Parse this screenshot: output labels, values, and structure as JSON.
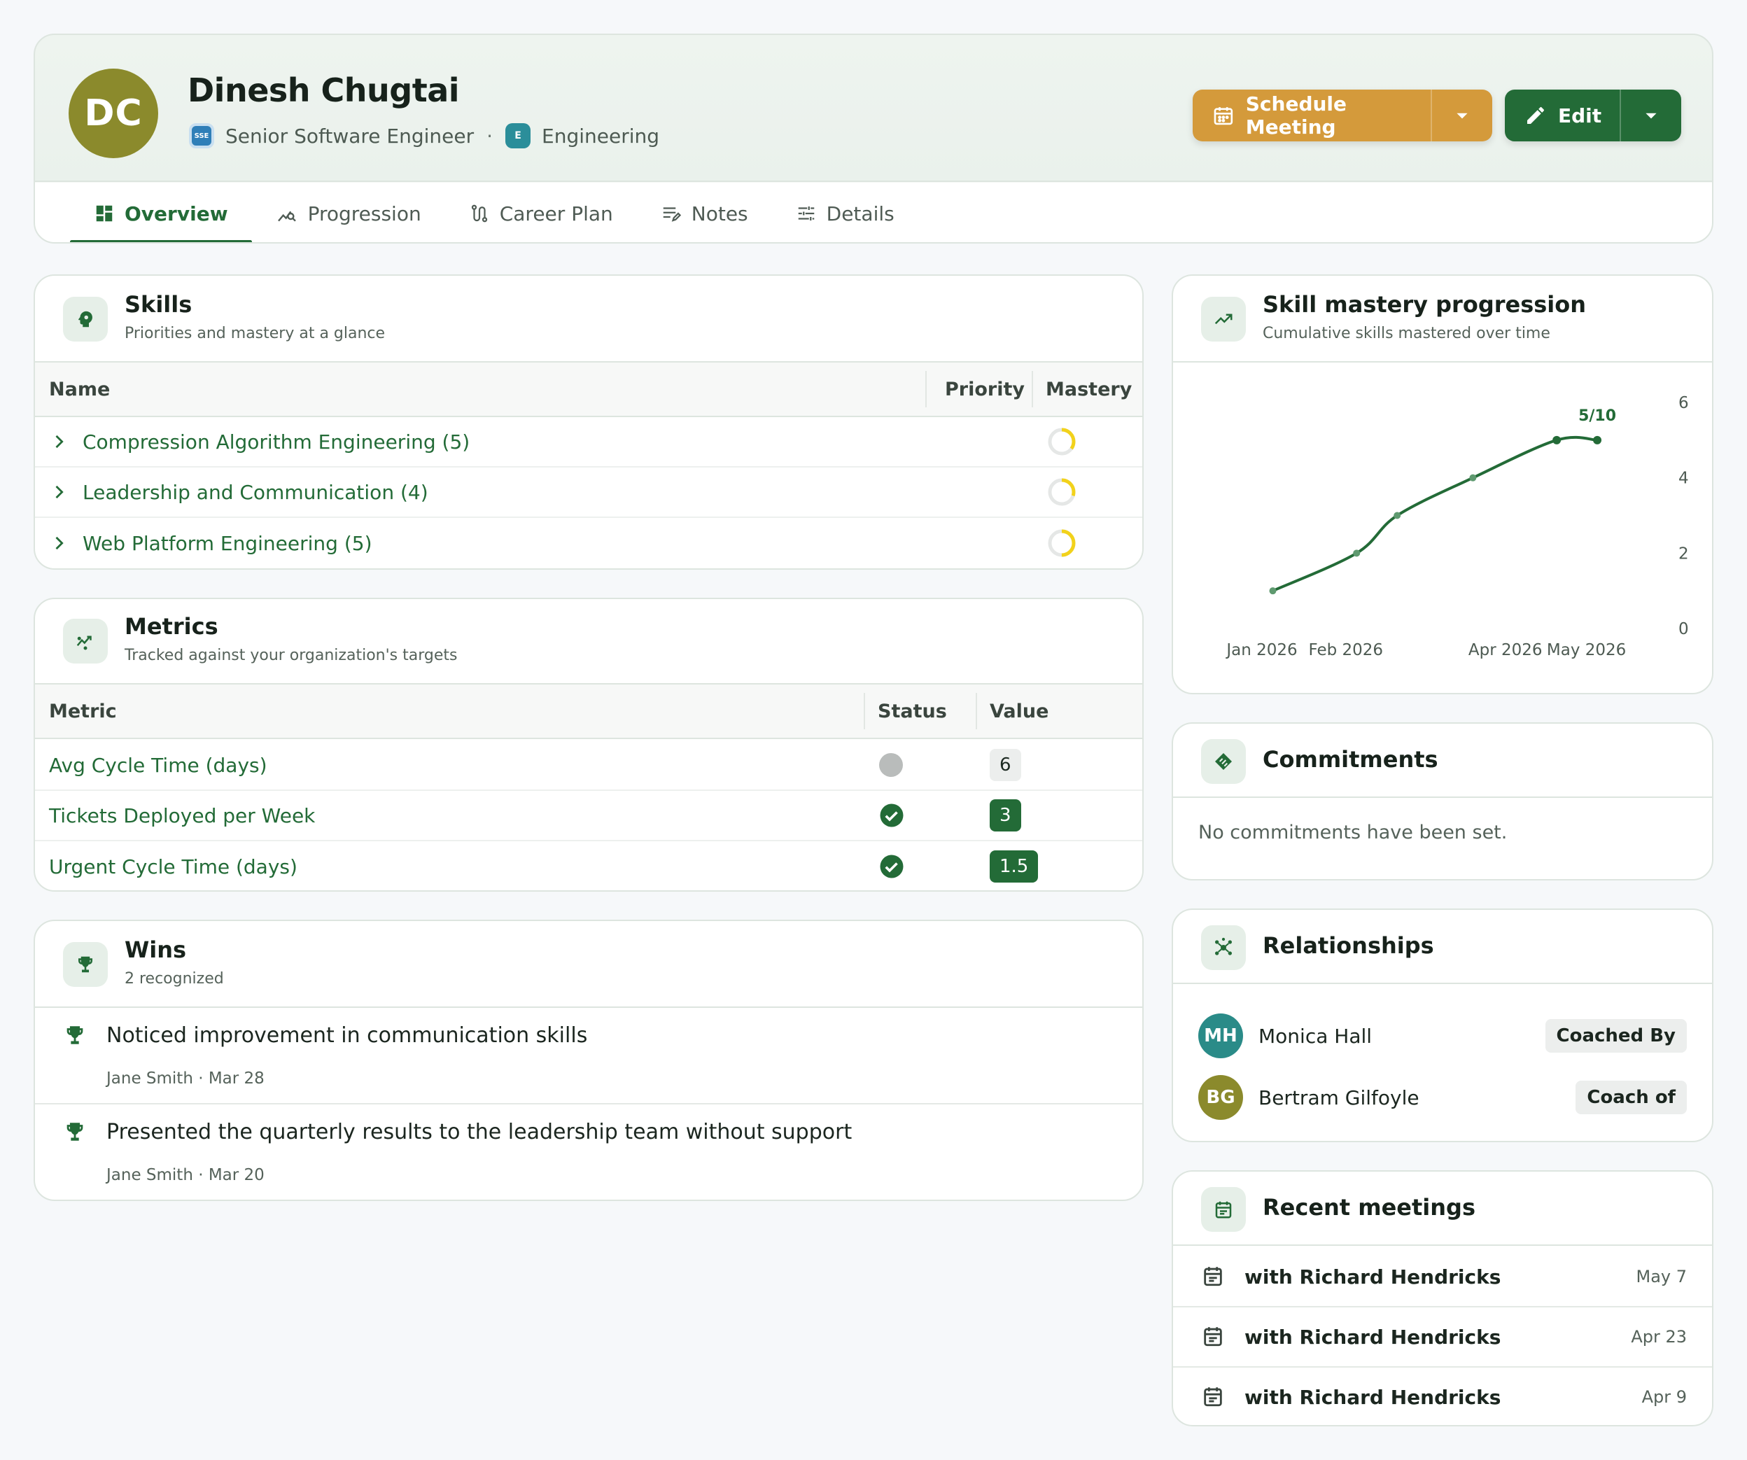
{
  "profile": {
    "initials": "DC",
    "name": "Dinesh Chugtai",
    "role_chip": "SSE",
    "role": "Senior Software Engineer",
    "separator": "·",
    "department_chip": "E",
    "department": "Engineering",
    "avatar_color": "#8b8a2c"
  },
  "actions": {
    "schedule_label": "Schedule Meeting",
    "edit_label": "Edit"
  },
  "tabs": [
    {
      "label": "Overview",
      "icon": "dashboard-icon",
      "active": true
    },
    {
      "label": "Progression",
      "icon": "trend-search-icon"
    },
    {
      "label": "Career Plan",
      "icon": "route-icon"
    },
    {
      "label": "Notes",
      "icon": "notes-icon"
    },
    {
      "label": "Details",
      "icon": "tune-icon"
    }
  ],
  "skills": {
    "title": "Skills",
    "subtitle": "Priorities and mastery at a glance",
    "columns": {
      "name": "Name",
      "priority": "Priority",
      "mastery": "Mastery"
    },
    "rows": [
      {
        "name": "Compression Algorithm Engineering (5)",
        "mastery": 0.35
      },
      {
        "name": "Leadership and Communication (4)",
        "mastery": 0.3
      },
      {
        "name": "Web Platform Engineering (5)",
        "mastery": 0.5
      }
    ]
  },
  "metrics": {
    "title": "Metrics",
    "subtitle": "Tracked against your organization's targets",
    "columns": {
      "metric": "Metric",
      "status": "Status",
      "value": "Value"
    },
    "rows": [
      {
        "name": "Avg Cycle Time (days)",
        "status": "neutral",
        "value": "6"
      },
      {
        "name": "Tickets Deployed per Week",
        "status": "good",
        "value": "3"
      },
      {
        "name": "Urgent Cycle Time (days)",
        "status": "good",
        "value": "1.5"
      }
    ]
  },
  "wins": {
    "title": "Wins",
    "subtitle": "2 recognized",
    "items": [
      {
        "text": "Noticed improvement in communication skills",
        "meta": "Jane Smith · Mar 28"
      },
      {
        "text": "Presented the quarterly results to the leadership team without support",
        "meta": "Jane Smith · Mar 20"
      }
    ]
  },
  "progression": {
    "title": "Skill mastery progression",
    "subtitle": "Cumulative skills mastered over time"
  },
  "chart_data": {
    "type": "line",
    "series": [
      {
        "points": [
          {
            "x": "2026-01-05",
            "y": 1
          },
          {
            "x": "2026-02-05",
            "y": 2
          },
          {
            "x": "2026-02-20",
            "y": 3
          },
          {
            "x": "2026-03-20",
            "y": 4
          },
          {
            "x": "2026-04-20",
            "y": 5
          },
          {
            "x": "2026-05-05",
            "y": 5
          }
        ]
      }
    ],
    "x_ticks": [
      "Jan 2026",
      "Feb 2026",
      "Apr 2026",
      "May 2026"
    ],
    "y_ticks": [
      "0",
      "2",
      "4",
      "6"
    ],
    "ylim": [
      0,
      6
    ],
    "xlim": [
      "2025-12-25",
      "2026-05-20"
    ],
    "last_label": "5/10",
    "y_axis_position": "right",
    "grid": false,
    "line_color": "#236b37"
  },
  "commitments": {
    "title": "Commitments",
    "empty_text": "No commitments have been set."
  },
  "relationships": {
    "title": "Relationships",
    "items": [
      {
        "initials": "MH",
        "name": "Monica Hall",
        "badge": "Coached By",
        "color": "#2a8b88"
      },
      {
        "initials": "BG",
        "name": "Bertram Gilfoyle",
        "badge": "Coach of",
        "color": "#8b8a2c"
      }
    ]
  },
  "meetings": {
    "title": "Recent meetings",
    "items": [
      {
        "title": "with Richard Hendricks",
        "date": "May 7"
      },
      {
        "title": "with Richard Hendricks",
        "date": "Apr 23"
      },
      {
        "title": "with Richard Hendricks",
        "date": "Apr 9"
      }
    ]
  }
}
